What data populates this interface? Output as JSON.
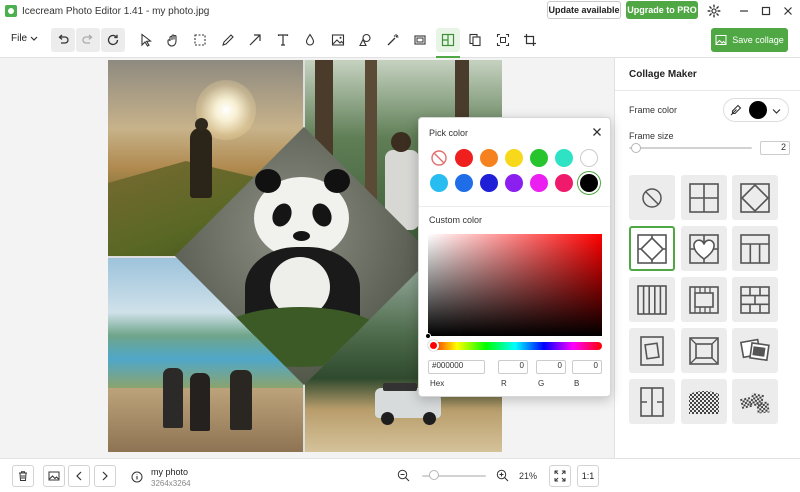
{
  "window": {
    "title": "Icecream Photo Editor 1.41 - my photo.jpg",
    "update_label": "Update available",
    "upgrade_label": "Upgrade to PRO"
  },
  "toolbar": {
    "file_label": "File",
    "save_label": "Save collage"
  },
  "panel": {
    "title": "Collage Maker",
    "frame_color_label": "Frame color",
    "frame_size_label": "Frame size",
    "frame_size_value": "2",
    "frame_color": "#000000",
    "frame_size_fraction": 0.06
  },
  "picker": {
    "title": "Pick color",
    "custom_label": "Custom color",
    "hex_value": "#000000",
    "r_value": "0",
    "g_value": "0",
    "b_value": "0",
    "hex_label": "Hex",
    "r_label": "R",
    "g_label": "G",
    "b_label": "B",
    "swatches": [
      "none",
      "#f01f1f",
      "#f5821f",
      "#f7d81a",
      "#27c42d",
      "#2de3c4",
      "#ffffff",
      "#27bdf0",
      "#1f6ee8",
      "#1f1fd8",
      "#8b1ff0",
      "#ea1ff0",
      "#ef1a6c",
      "#000000"
    ]
  },
  "bottom": {
    "file_name": "my photo",
    "file_dims": "3264x3264",
    "zoom": "21%",
    "zoom_fraction": 0.18,
    "one_to_one": "1:1"
  },
  "colors": {
    "accent": "#4fa843"
  }
}
